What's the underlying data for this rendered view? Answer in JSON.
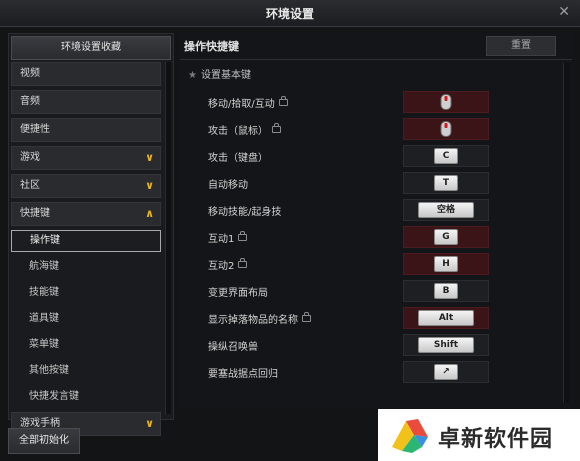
{
  "window": {
    "title": "环境设置",
    "close_glyph": "✕"
  },
  "sidebar": {
    "favorite_label": "环境设置收藏",
    "items": [
      {
        "label": "视频",
        "chevron": ""
      },
      {
        "label": "音频",
        "chevron": ""
      },
      {
        "label": "便捷性",
        "chevron": ""
      },
      {
        "label": "游戏",
        "chevron": "down"
      },
      {
        "label": "社区",
        "chevron": "down"
      },
      {
        "label": "快捷键",
        "chevron": "up"
      }
    ],
    "subitems": [
      "操作键",
      "航海键",
      "技能键",
      "道具键",
      "菜单键",
      "其他按键",
      "快捷发言键"
    ],
    "active_subitem": "操作键",
    "bottom_item": {
      "label": "游戏手柄",
      "chevron": "down"
    },
    "reset_all_label": "全部初始化"
  },
  "main": {
    "section_title": "操作快捷键",
    "reset_label": "重置",
    "basic_label": "设置基本键",
    "rows": [
      {
        "label": "移动/拾取/互动",
        "locked": true,
        "key": "mouse",
        "red": true
      },
      {
        "label": "攻击（鼠标）",
        "locked": true,
        "key": "mouse",
        "red": true
      },
      {
        "label": "攻击（键盘）",
        "locked": false,
        "key": "C",
        "red": false
      },
      {
        "label": "自动移动",
        "locked": false,
        "key": "T",
        "red": false
      },
      {
        "label": "移动技能/起身技",
        "locked": false,
        "key": "空格",
        "red": false,
        "wide": true
      },
      {
        "label": "互动1",
        "locked": true,
        "key": "G",
        "red": true
      },
      {
        "label": "互动2",
        "locked": true,
        "key": "H",
        "red": true
      },
      {
        "label": "变更界面布局",
        "locked": false,
        "key": "B",
        "red": false
      },
      {
        "label": "显示掉落物品的名称",
        "locked": true,
        "key": "Alt",
        "red": true,
        "wide": true
      },
      {
        "label": "操纵召唤兽",
        "locked": false,
        "key": "Shift",
        "red": false,
        "wide": true
      },
      {
        "label": "要塞战据点回归",
        "locked": false,
        "key": "↗",
        "red": false
      }
    ]
  },
  "brand": {
    "text": "卓新软件园"
  },
  "colors": {
    "accent": "#e6b423",
    "lock_red": "#3a1416",
    "mouse_red": "#d4161f"
  }
}
